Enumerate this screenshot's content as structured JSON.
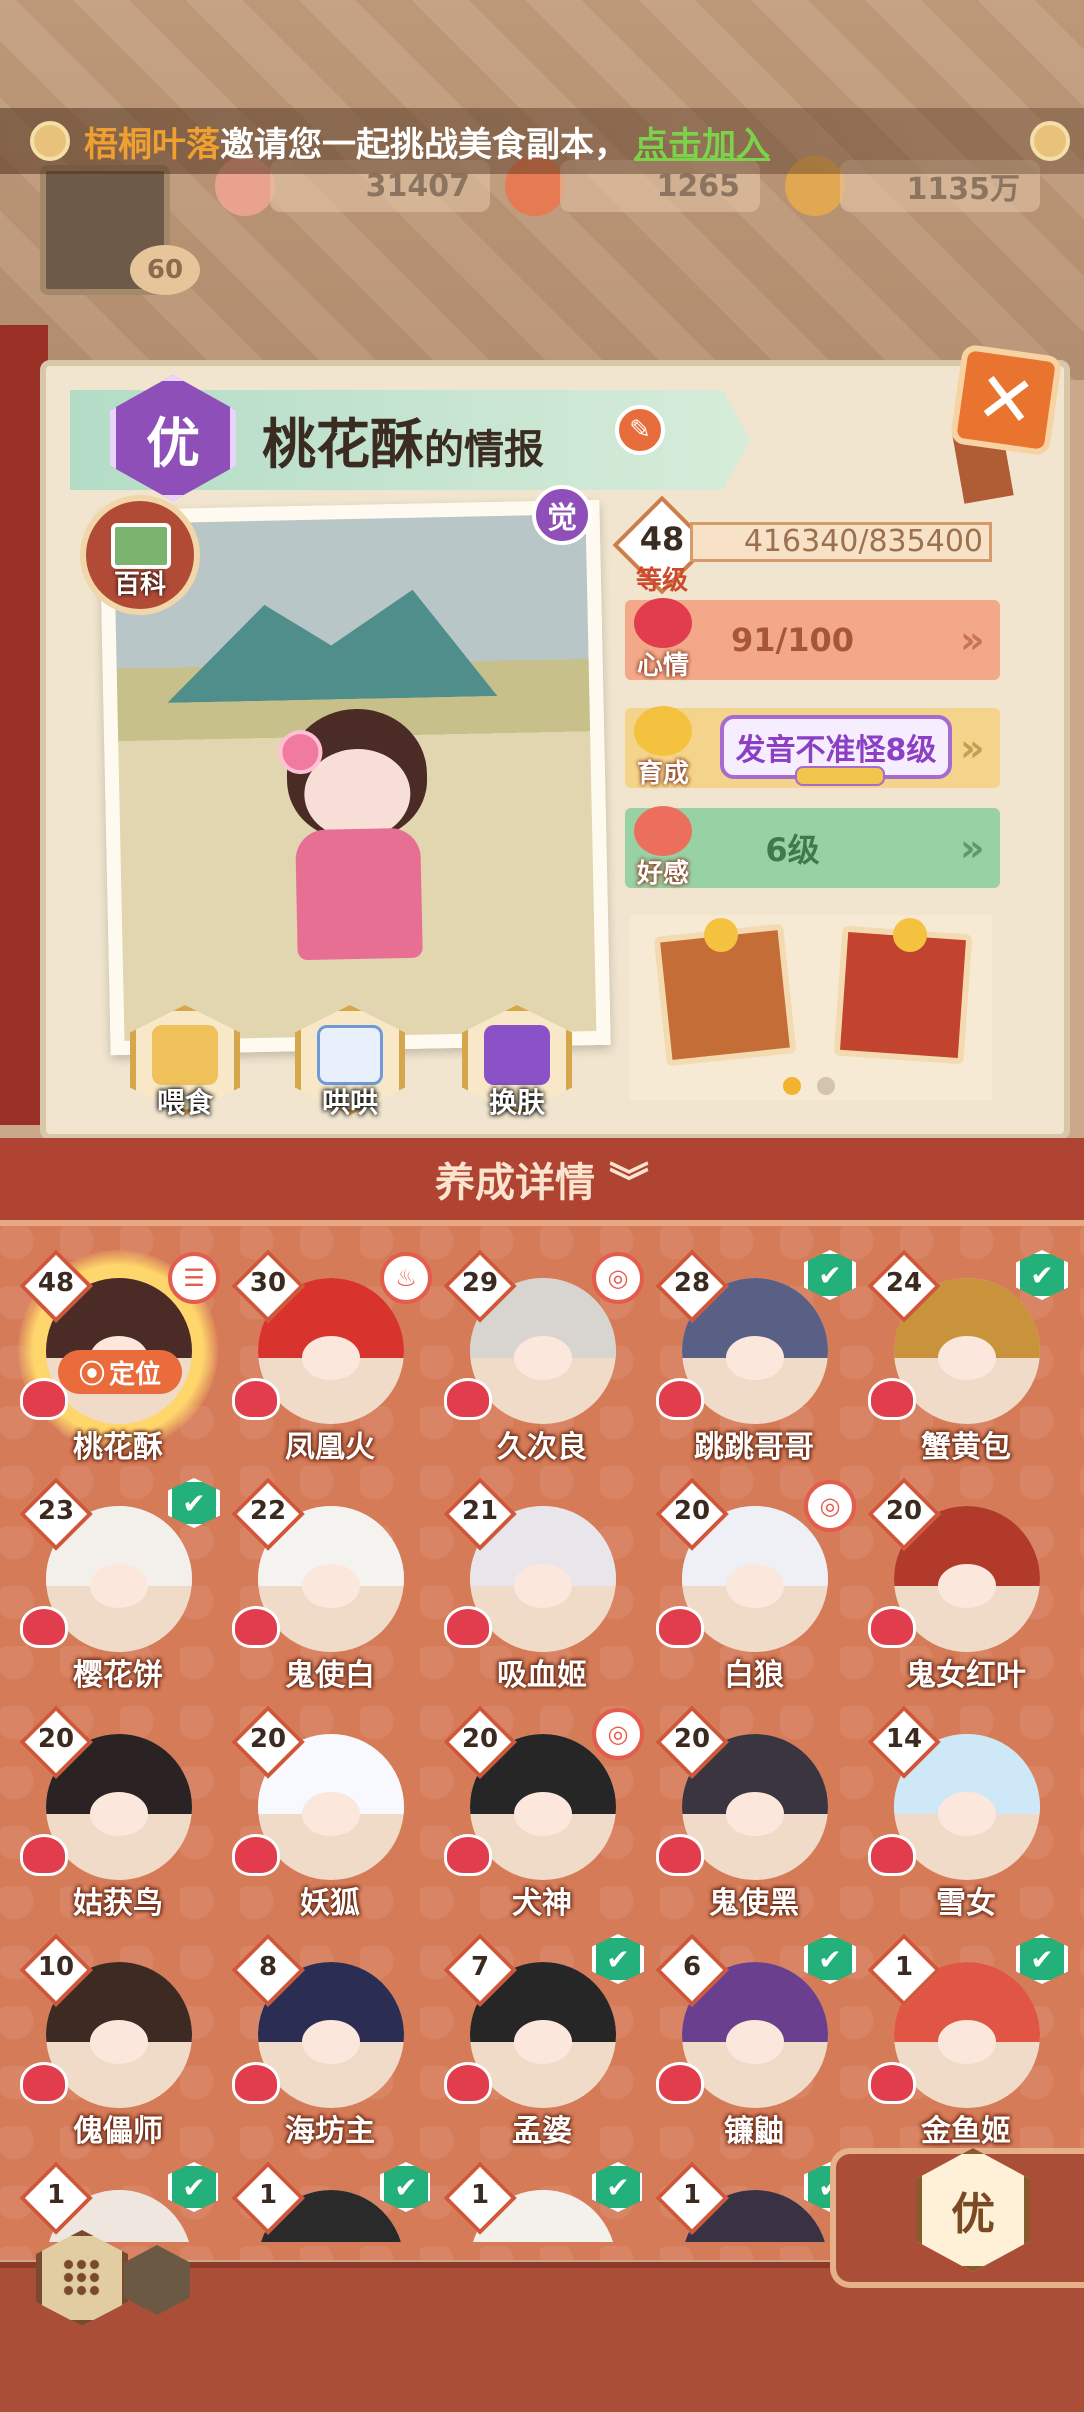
{
  "invite": {
    "inviter": "梧桐叶落",
    "message": "邀请您一起挑战美食副本，",
    "join_label": "点击加入"
  },
  "resources": {
    "gem": "31407",
    "coin_a": "1265",
    "coin_b": "1135万",
    "player_level": "60"
  },
  "header": {
    "grade": "优",
    "char_name": "桃花酥",
    "title_suffix": "的情报",
    "awake_badge": "觉",
    "wiki_label": "百科"
  },
  "stats": {
    "level": "48",
    "level_label": "等级",
    "exp": "416340/835400",
    "mood_label": "心情",
    "mood_value": "91/100",
    "train_label": "育成",
    "train_value": "发音不准怪8级",
    "favor_label": "好感",
    "favor_value": "6级",
    "arrow": "»"
  },
  "actions": {
    "feed": "喂食",
    "coax": "哄哄",
    "skin": "换肤"
  },
  "detail_bar": {
    "label": "养成详情",
    "chevron": "︾"
  },
  "roster": [
    {
      "level": "48",
      "name": "桃花酥",
      "badge": "tag",
      "tag": "☰"
    },
    {
      "level": "30",
      "name": "凤凰火",
      "badge": "tag",
      "tag": "♨"
    },
    {
      "level": "29",
      "name": "久次良",
      "badge": "tag",
      "tag": "◎"
    },
    {
      "level": "28",
      "name": "跳跳哥哥",
      "badge": "check"
    },
    {
      "level": "24",
      "name": "蟹黄包",
      "badge": "check"
    },
    {
      "level": "23",
      "name": "樱花饼",
      "badge": "check"
    },
    {
      "level": "22",
      "name": "鬼使白",
      "badge": "none"
    },
    {
      "level": "21",
      "name": "吸血姬",
      "badge": "none"
    },
    {
      "level": "20",
      "name": "白狼",
      "badge": "tag",
      "tag": "◎"
    },
    {
      "level": "20",
      "name": "鬼女红叶",
      "badge": "none"
    },
    {
      "level": "20",
      "name": "姑获鸟",
      "badge": "none"
    },
    {
      "level": "20",
      "name": "妖狐",
      "badge": "none"
    },
    {
      "level": "20",
      "name": "犬神",
      "badge": "tag",
      "tag": "◎"
    },
    {
      "level": "20",
      "name": "鬼使黑",
      "badge": "none"
    },
    {
      "level": "14",
      "name": "雪女",
      "badge": "none"
    },
    {
      "level": "10",
      "name": "傀儡师",
      "badge": "none"
    },
    {
      "level": "8",
      "name": "海坊主",
      "badge": "none"
    },
    {
      "level": "7",
      "name": "孟婆",
      "badge": "check"
    },
    {
      "level": "6",
      "name": "镰鼬",
      "badge": "check"
    },
    {
      "level": "1",
      "name": "金鱼姬",
      "badge": "check"
    },
    {
      "level": "1",
      "name": "",
      "badge": "check"
    },
    {
      "level": "1",
      "name": "",
      "badge": "check"
    },
    {
      "level": "1",
      "name": "",
      "badge": "check"
    },
    {
      "level": "1",
      "name": "",
      "badge": "check"
    }
  ],
  "locate_label": "定位",
  "check_glyph": "✔",
  "filter_grade": "优",
  "colors": {
    "accent_red": "#b04432",
    "purple": "#8e4fb8",
    "check_green": "#23b07a"
  }
}
